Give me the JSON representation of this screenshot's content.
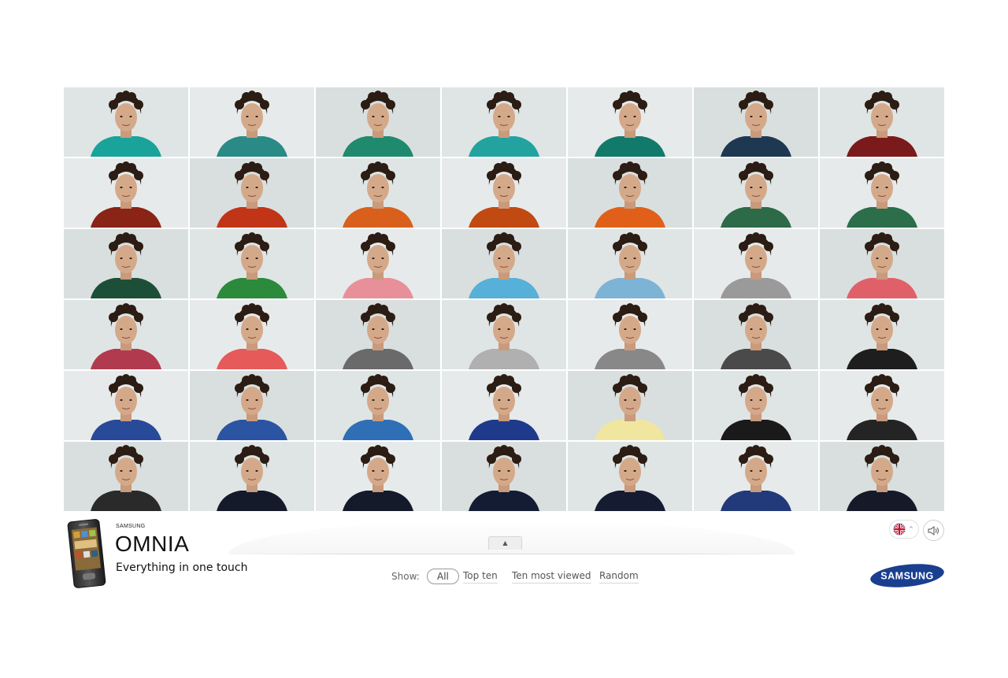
{
  "brand": {
    "company_small": "SAMSUNG",
    "product": "OMNIA",
    "tagline": "Everything in one touch",
    "logo_text": "SAMSUNG",
    "logo_color": "#1a3f8f"
  },
  "filters": {
    "label": "Show:",
    "options": [
      "All",
      "Top ten",
      "Ten most viewed",
      "Random"
    ],
    "selected": "All"
  },
  "controls": {
    "toggle_icon": "▲",
    "language_icon": "uk-flag-icon",
    "language_caret": "^",
    "sound_icon": "speaker-icon"
  },
  "grid": {
    "columns": 7,
    "rows": 6,
    "shirt_colors": [
      "#1aa39a",
      "#2a8a86",
      "#1f8a6e",
      "#22a3a0",
      "#127a6b",
      "#1f3852",
      "#7a1a1a",
      "#8a2416",
      "#c23418",
      "#d9601c",
      "#c04a12",
      "#e0601a",
      "#2c6a48",
      "#2b6e49",
      "#1d4f38",
      "#2c8a3c",
      "#e8909a",
      "#56b0d8",
      "#7db4d6",
      "#9a9a9a",
      "#e0606a",
      "#b23a4e",
      "#e65a5a",
      "#6a6a6a",
      "#b0b0b0",
      "#888888",
      "#4a4a4a",
      "#1e1e1e",
      "#284a98",
      "#2b54a3",
      "#2f6fb5",
      "#1f3a8a",
      "#f0e6a0",
      "#1a1a1a",
      "#242424",
      "#2a2a2a",
      "#151a2a",
      "#151a2a",
      "#141c34",
      "#151b30",
      "#223a7a",
      "#161a28"
    ]
  }
}
